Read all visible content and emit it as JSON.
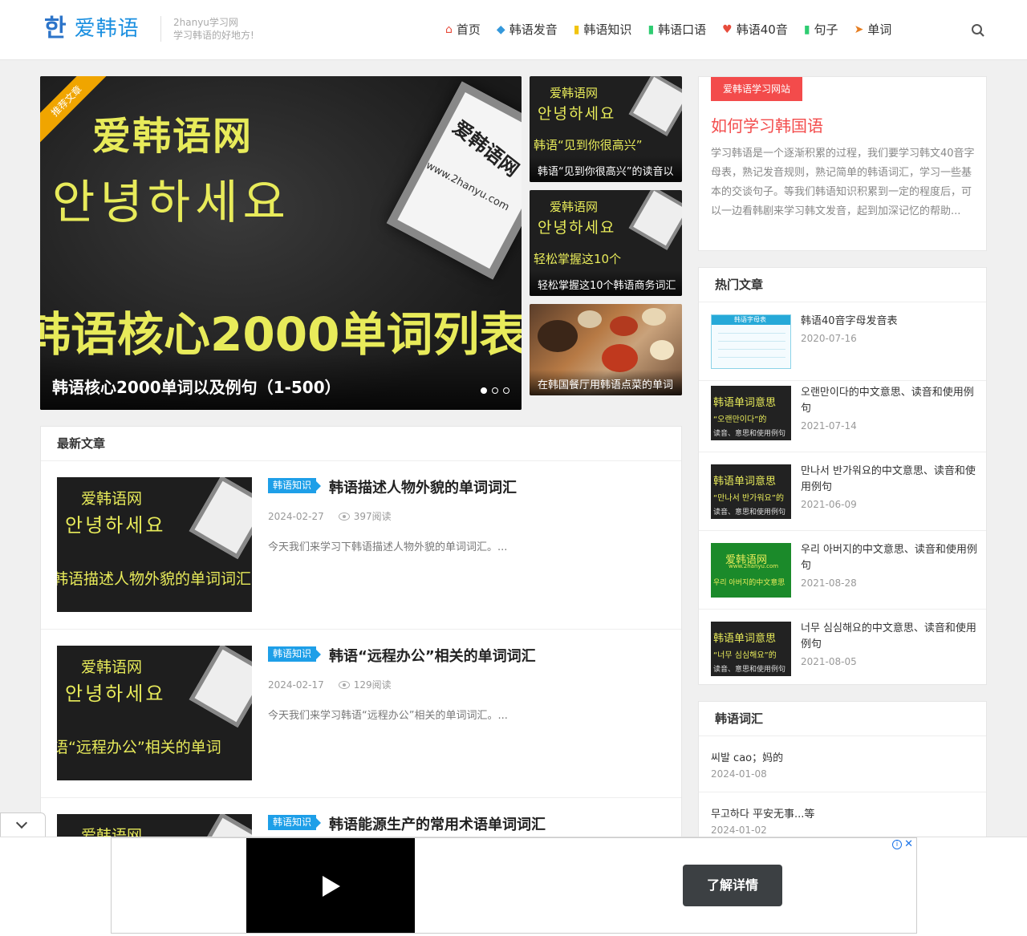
{
  "header": {
    "logo_mark": "한",
    "logo_text": "爱韩语",
    "site_name": "2hanyu学习网",
    "slogan": "学习韩语的好地方!",
    "nav": [
      {
        "label": "首页",
        "icon": "home-icon",
        "glyph": "⌂",
        "color": "#e74c3c"
      },
      {
        "label": "韩语发音",
        "icon": "tag-icon",
        "glyph": "◆",
        "color": "#3498db"
      },
      {
        "label": "韩语知识",
        "icon": "file-icon",
        "glyph": "▮",
        "color": "#f1c40f"
      },
      {
        "label": "韩语口语",
        "icon": "bookmark-icon",
        "glyph": "▮",
        "color": "#2ecc71"
      },
      {
        "label": "韩语40音",
        "icon": "heart-icon",
        "glyph": "♥",
        "color": "#e74c3c"
      },
      {
        "label": "句子",
        "icon": "bookmark-icon",
        "glyph": "▮",
        "color": "#2ecc71"
      },
      {
        "label": "单词",
        "icon": "send-icon",
        "glyph": "➤",
        "color": "#e67e22"
      }
    ]
  },
  "featured": {
    "ribbon": "推荐文章",
    "img_line1": "爱韩语网",
    "img_line2": "안녕하세요",
    "img_line3": "韩语核心2000单词列表",
    "sign_text1": "爱韩语网",
    "sign_text2": "www.2hanyu.com",
    "title": "韩语核心2000单词以及例句（1-500）",
    "slides": 3,
    "active_slide": 1
  },
  "thumbs": [
    {
      "img1": "爱韩语网",
      "img2": "안녕하세요",
      "img3": "韩语“见到你很高兴”",
      "caption": "韩语“见到你很高兴”的读音以"
    },
    {
      "img1": "爱韩语网",
      "img2": "안녕하세요",
      "img3": "轻松掌握这10个",
      "caption": "轻松掌握这10个韩语商务词汇"
    },
    {
      "caption": "在韩国餐厅用韩语点菜的单词"
    }
  ],
  "latest": {
    "heading": "最新文章",
    "posts": [
      {
        "category": "韩语知识",
        "title": "韩语描述人物外貌的单词词汇",
        "date": "2024-02-27",
        "views": "397阅读",
        "excerpt": "今天我们来学习下韩语描述人物外貌的单词词汇。...",
        "img_a": "爱韩语网",
        "img_b": "안녕하세요",
        "img_c": "韩语描述人物外貌的单词词汇"
      },
      {
        "category": "韩语知识",
        "title": "韩语“远程办公”相关的单词词汇",
        "date": "2024-02-17",
        "views": "129阅读",
        "excerpt": "今天我们来学习韩语“远程办公”相关的单词词汇。...",
        "img_a": "爱韩语网",
        "img_b": "안녕하세요",
        "img_c": "语“远程办公”相关的单词"
      },
      {
        "category": "韩语知识",
        "title": "韩语能源生产的常用术语单词词汇",
        "img_a": "爱韩语网"
      }
    ]
  },
  "sidebar": {
    "intro": {
      "tag": "爱韩语学习网站",
      "title": "如何学习韩国语",
      "desc": "学习韩语是一个逐渐积累的过程，我们要学习韩文40音字母表，熟记发音规则，熟记简单的韩语词汇，学习一些基本的交谈句子。等我们韩语知识积累到一定的程度后，可以一边看韩剧来学习韩文发音，起到加深记忆的帮助..."
    },
    "hot": {
      "heading": "热门文章",
      "items": [
        {
          "title": "韩语40音字母发音表",
          "date": "2020-07-16",
          "chart_title": "韩语字母表"
        },
        {
          "title": "오랜만이다的中文意思、读音和使用例句",
          "date": "2021-07-14",
          "img_x": "韩语单词意思",
          "img_y": "“오랜만이다”的",
          "img_z": "读音、意思和使用例句"
        },
        {
          "title": "만나서 반가워요的中文意思、读音和使用例句",
          "date": "2021-06-09",
          "img_x": "韩语单词意思",
          "img_y": "“만나서 반가워요”的",
          "img_z": "读音、意思和使用例句"
        },
        {
          "title": "우리 아버지的中文意思、读音和使用例句",
          "date": "2021-08-28",
          "img_x": "爱韩语网",
          "img_y": "www.2hanyu.com",
          "img_z": "우리 아버지的中文意思"
        },
        {
          "title": "너무 심심해요的中文意思、读音和使用例句",
          "date": "2021-08-05",
          "img_x": "韩语单词意思",
          "img_y": "“너무 심심해요”的",
          "img_z": "读音、意思和使用例句"
        }
      ]
    },
    "words": {
      "heading": "韩语词汇",
      "items": [
        {
          "word": "씨발 cao；妈的",
          "date": "2024-01-08"
        },
        {
          "word": "무고하다 平安无事...等",
          "date": "2024-01-02"
        }
      ]
    }
  },
  "ad": {
    "cta": "了解详情",
    "info": "i",
    "close": "✕"
  }
}
